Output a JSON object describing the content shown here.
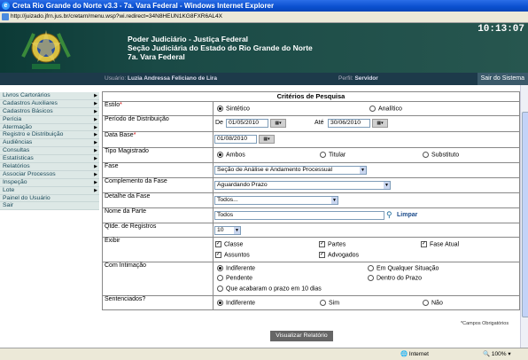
{
  "window": {
    "title": "Creta Rio Grande do Norte v3.3 - 7a. Vara Federal - Windows Internet Explorer"
  },
  "address": {
    "url": "http://juizado.jfrn.jus.br/cretarn/menu.wsp?wi.redirect=34N8HEUN1KG8FXR6AL4X"
  },
  "header": {
    "line1": "Poder Judiciário - Justiça Federal",
    "line2": "Seção Judiciária do Estado do Rio Grande do Norte",
    "line3": "7a. Vara Federal",
    "clock": "10:13:07"
  },
  "userbar": {
    "user_label": "Usuário:",
    "user_name": "Luzia Andressa Feliciano de Lira",
    "profile_label": "Perfil:",
    "profile": "Servidor",
    "exit": "Sair do Sistema"
  },
  "menu": [
    {
      "label": "Livros Cartorários",
      "arrow": true
    },
    {
      "label": "Cadastros Auxiliares",
      "arrow": true
    },
    {
      "label": "Cadastros Básicos",
      "arrow": true
    },
    {
      "label": "Perícia",
      "arrow": true
    },
    {
      "label": "Atermação",
      "arrow": true
    },
    {
      "label": "Registro e Distribuição",
      "arrow": true
    },
    {
      "label": "Audiências",
      "arrow": true
    },
    {
      "label": "Consultas",
      "arrow": true
    },
    {
      "label": "Estatísticas",
      "arrow": true
    },
    {
      "label": "Relatórios",
      "arrow": true
    },
    {
      "label": "Associar Processos",
      "arrow": true
    },
    {
      "label": "Inspeção",
      "arrow": true
    },
    {
      "label": "Lote",
      "arrow": true
    },
    {
      "label": "Painel do Usuário",
      "arrow": false
    },
    {
      "label": "Sair",
      "arrow": false
    }
  ],
  "form": {
    "title": "Critérios de Pesquisa",
    "estilo": {
      "label": "Estilo",
      "req": "*",
      "opt1": "Sintético",
      "opt2": "Analítico"
    },
    "periodo": {
      "label": "Período de Distribuição",
      "de": "De",
      "from": "01/05/2010",
      "ate": "Até",
      "to": "30/06/2010"
    },
    "database": {
      "label": "Data Base",
      "req": "*",
      "value": "01/08/2010"
    },
    "tipo": {
      "label": "Tipo Magistrado",
      "opt1": "Ambos",
      "opt2": "Titular",
      "opt3": "Substituto"
    },
    "fase": {
      "label": "Fase",
      "value": "Seção de Análise e Andamento Processual"
    },
    "complemento": {
      "label": "Complemento da Fase",
      "value": "Aguardando Prazo"
    },
    "detalhe": {
      "label": "Detalhe da Fase",
      "value": "Todos..."
    },
    "parte": {
      "label": "Nome da Parte",
      "value": "Todos",
      "limpar": "Limpar"
    },
    "qtde": {
      "label": "Qtde. de Registros",
      "value": "10"
    },
    "exibir": {
      "label": "Exibir",
      "c1": "Classe",
      "c2": "Partes",
      "c3": "Fase Atual",
      "c4": "Assuntos",
      "c5": "Advogados"
    },
    "intimacao": {
      "label": "Com Intimação",
      "o1": "Indiferente",
      "o2": "Em Qualquer Situação",
      "o3": "Pendente",
      "o4": "Dentro do Prazo",
      "o5": "Que acabaram o prazo em 10 dias"
    },
    "sentenciados": {
      "label": "Sentenciados?",
      "o1": "Indiferente",
      "o2": "Sim",
      "o3": "Não"
    },
    "obrigatorios": "*Campos Obrigatórios",
    "submit": "Visualizar Relatório"
  },
  "status": {
    "zone": "Internet",
    "zoom": "100%"
  }
}
